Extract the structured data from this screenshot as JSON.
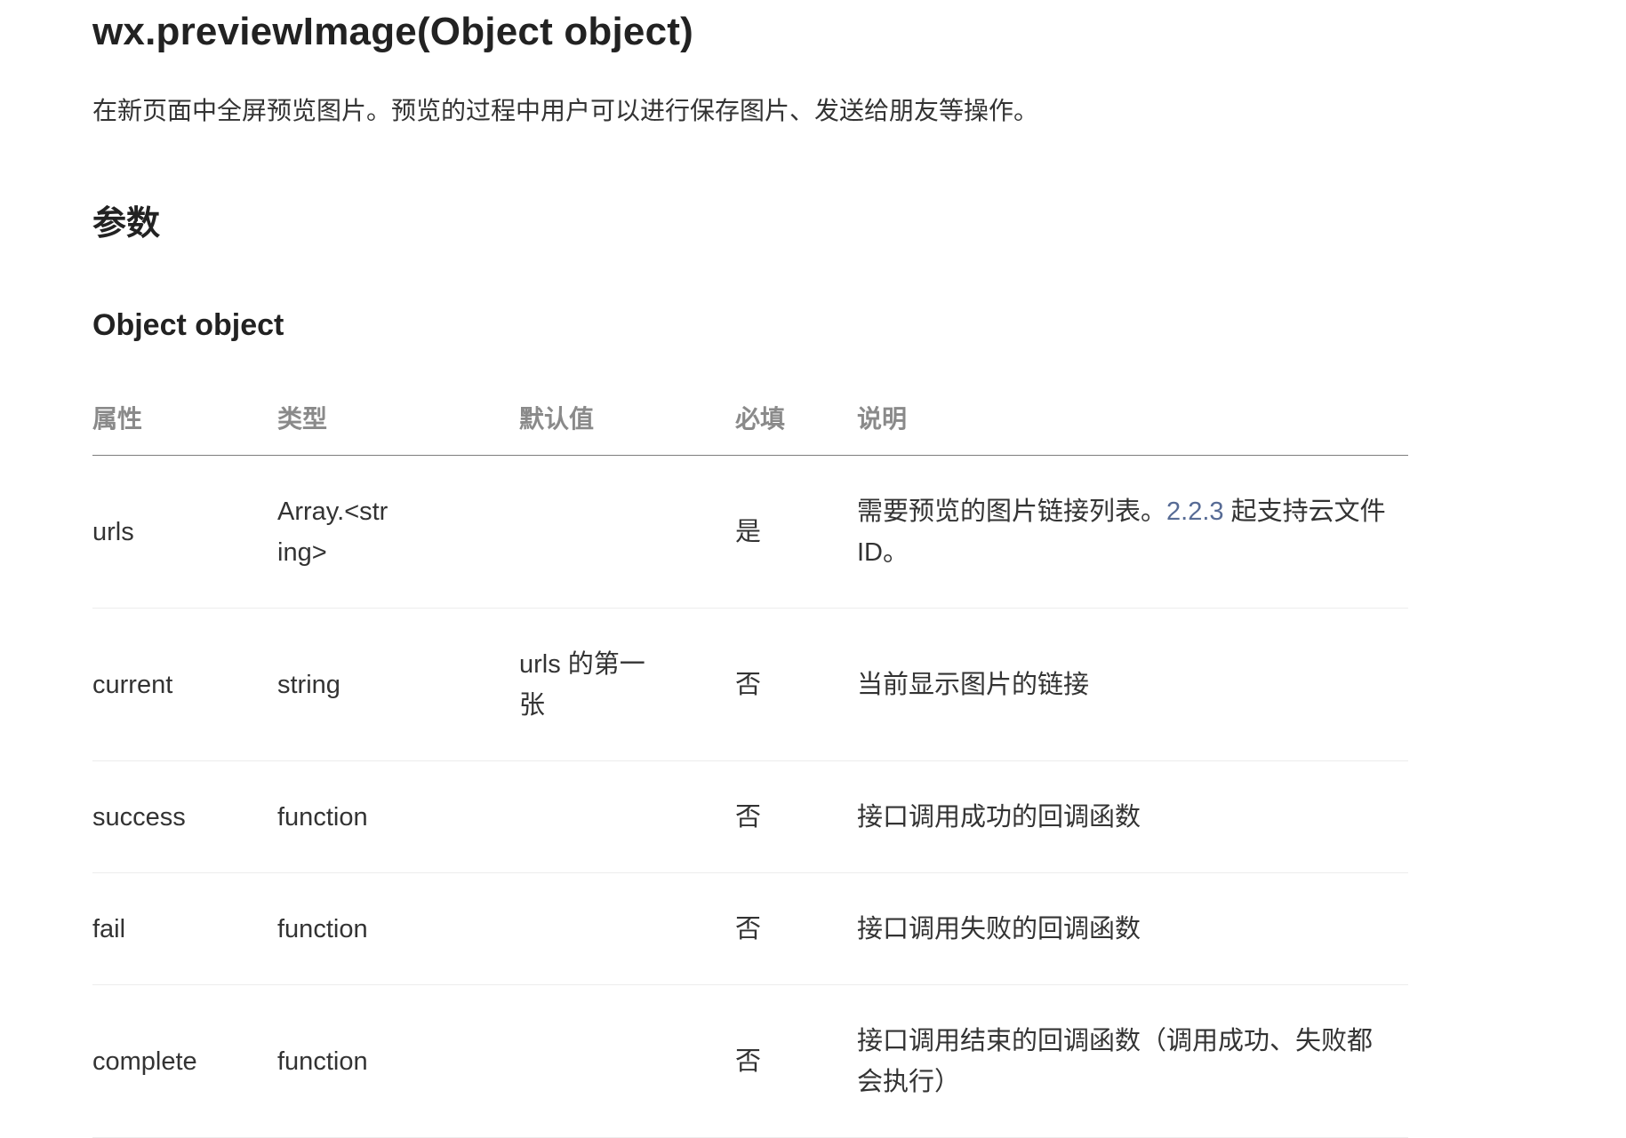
{
  "title": "wx.previewImage(Object object)",
  "description": "在新页面中全屏预览图片。预览的过程中用户可以进行保存图片、发送给朋友等操作。",
  "section_params": "参数",
  "object_heading": "Object object",
  "table": {
    "headers": [
      "属性",
      "类型",
      "默认值",
      "必填",
      "说明"
    ],
    "rows": [
      {
        "name": "urls",
        "type": "Array.<string>",
        "default": "",
        "required": "是",
        "desc_before": "需要预览的图片链接列表。",
        "desc_link": "2.2.3",
        "desc_after": " 起支持云文件ID。"
      },
      {
        "name": "current",
        "type": "string",
        "default": "urls 的第一张",
        "required": "否",
        "desc": "当前显示图片的链接"
      },
      {
        "name": "success",
        "type": "function",
        "default": "",
        "required": "否",
        "desc": "接口调用成功的回调函数"
      },
      {
        "name": "fail",
        "type": "function",
        "default": "",
        "required": "否",
        "desc": "接口调用失败的回调函数"
      },
      {
        "name": "complete",
        "type": "function",
        "default": "",
        "required": "否",
        "desc": "接口调用结束的回调函数（调用成功、失败都会执行）"
      }
    ]
  },
  "colors": {
    "link": "#576b95",
    "header_text": "#8a8a8a",
    "body_text": "#333333"
  }
}
